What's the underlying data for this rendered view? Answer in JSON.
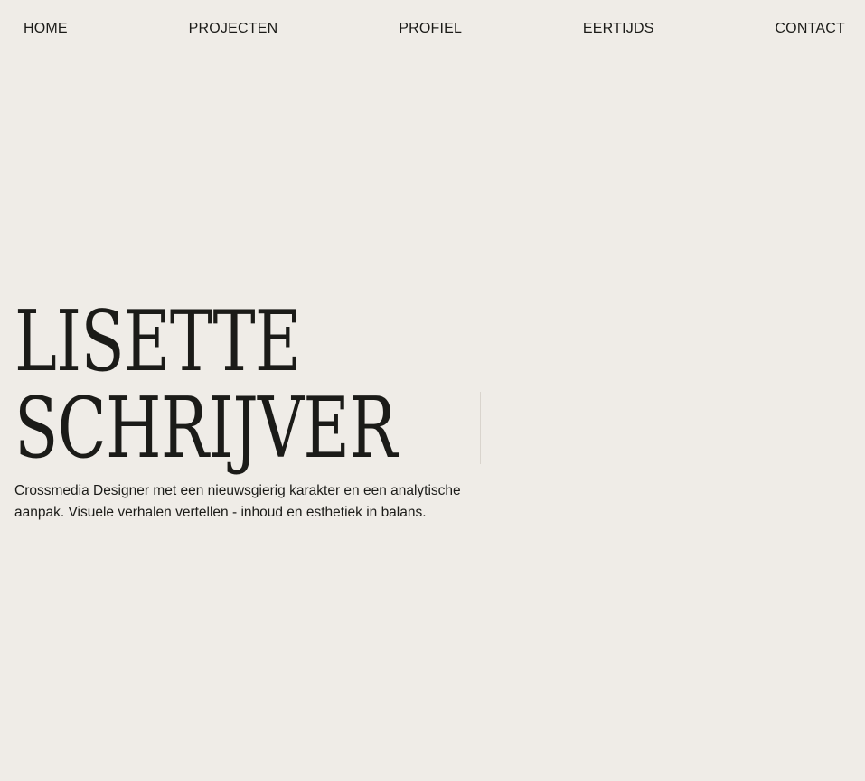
{
  "nav": {
    "items": [
      {
        "label": "HOME"
      },
      {
        "label": "PROJECTEN"
      },
      {
        "label": "PROFIEL"
      },
      {
        "label": "EERTIJDS"
      },
      {
        "label": "CONTACT"
      }
    ]
  },
  "hero": {
    "title_line_1": "LISETTE",
    "title_line_2": "SCHRIJVER",
    "subtitle_line_1": "Crossmedia Designer met een nieuwsgierig karakter en een analytische",
    "subtitle_line_2": "aanpak. Visuele verhalen vertellen - inhoud en esthetiek in balans."
  },
  "colors": {
    "background": "#efece7",
    "text": "#1b1b18"
  }
}
